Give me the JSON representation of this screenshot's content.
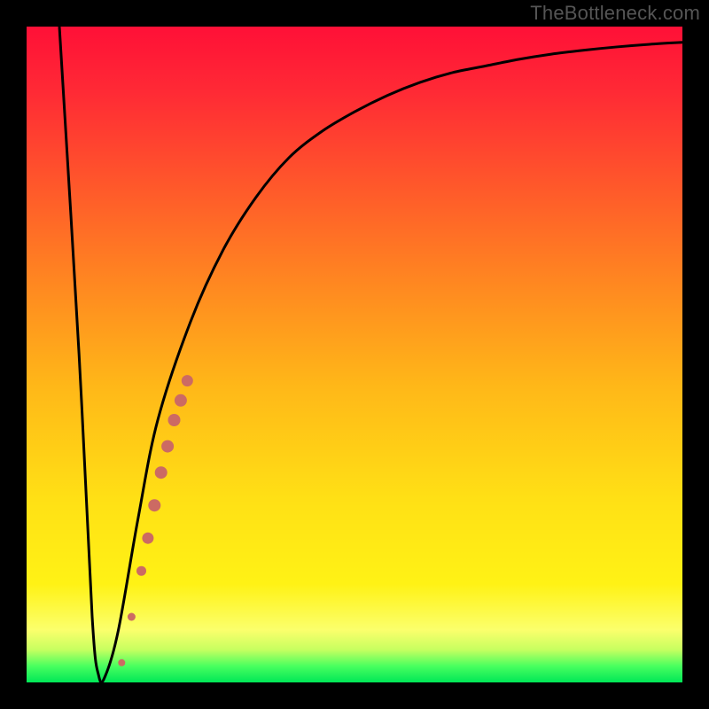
{
  "watermark": {
    "text": "TheBottleneck.com"
  },
  "colors": {
    "curve": "#000000",
    "dots_fill": "#cc6a63",
    "dots_stroke": "#cc6a63",
    "frame": "#000000",
    "gradient_top": "#ff1037",
    "gradient_bottom": "#00e757"
  },
  "plot": {
    "inner_width": 740,
    "inner_height": 740
  },
  "chart_data": {
    "type": "line",
    "title": "",
    "xlabel": "",
    "ylabel": "",
    "xlim": [
      0,
      100
    ],
    "ylim": [
      0,
      100
    ],
    "series": [
      {
        "name": "bottleneck-curve",
        "x": [
          5,
          8,
          10,
          11,
          12,
          14,
          17,
          20,
          25,
          30,
          35,
          40,
          45,
          50,
          55,
          60,
          65,
          70,
          75,
          80,
          85,
          90,
          95,
          100
        ],
        "y": [
          100,
          50,
          10,
          1,
          1,
          8,
          25,
          40,
          55,
          66,
          74,
          80,
          84,
          87,
          89.5,
          91.5,
          93,
          94,
          95,
          95.8,
          96.4,
          96.9,
          97.3,
          97.6
        ]
      }
    ],
    "annotations": {
      "notch_x": 11.5,
      "notch_y": 1
    },
    "dot_series": {
      "name": "highlight-dots",
      "comment": "rendered as salmon dots along the rising arm of the curve",
      "points": [
        {
          "x": 14.5,
          "y": 3,
          "r": 4.0
        },
        {
          "x": 16.0,
          "y": 10,
          "r": 4.5
        },
        {
          "x": 17.5,
          "y": 17,
          "r": 5.5
        },
        {
          "x": 18.5,
          "y": 22,
          "r": 6.5
        },
        {
          "x": 19.5,
          "y": 27,
          "r": 7.0
        },
        {
          "x": 20.5,
          "y": 32,
          "r": 7.0
        },
        {
          "x": 21.5,
          "y": 36,
          "r": 7.0
        },
        {
          "x": 22.5,
          "y": 40,
          "r": 7.0
        },
        {
          "x": 23.5,
          "y": 43,
          "r": 7.0
        },
        {
          "x": 24.5,
          "y": 46,
          "r": 6.5
        }
      ]
    }
  }
}
